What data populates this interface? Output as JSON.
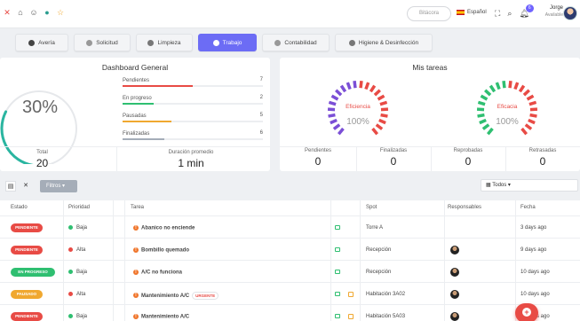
{
  "header": {
    "bitacora_label": "Bitácora",
    "language_label": "Español",
    "notification_count": "6",
    "user_name": "Jorge",
    "user_status": "Available"
  },
  "tabs": [
    {
      "label": "Avería",
      "active": false
    },
    {
      "label": "Solicitud",
      "active": false
    },
    {
      "label": "Limpieza",
      "active": false
    },
    {
      "label": "Trabajo",
      "active": true
    },
    {
      "label": "Contabilidad",
      "active": false
    },
    {
      "label": "Higiene & Desinfección",
      "active": false
    }
  ],
  "dashboard": {
    "title": "Dashboard General",
    "percent": "30%",
    "percent_value": 0.3,
    "stats": [
      {
        "label": "Pendientes",
        "value": "7",
        "color": "#e84b45",
        "fill": 0.5
      },
      {
        "label": "En progreso",
        "value": "2",
        "color": "#2fbf71",
        "fill": 0.22
      },
      {
        "label": "Pausadas",
        "value": "5",
        "color": "#f0a830",
        "fill": 0.35
      },
      {
        "label": "Finalizadas",
        "value": "6",
        "color": "#a5adb8",
        "fill": 0.3
      }
    ],
    "total_label": "Total",
    "total_value": "20",
    "duration_label": "Duración promedio",
    "duration_value": "1 min"
  },
  "mytasks": {
    "title": "Mis tareas",
    "efficiency_label": "Eficiencia",
    "efficiency_pct": "100%",
    "efficacy_label": "Eficacia",
    "efficacy_pct": "100%",
    "counts": [
      {
        "label": "Pendientes",
        "value": "0"
      },
      {
        "label": "Finalizadas",
        "value": "0"
      },
      {
        "label": "Reprobadas",
        "value": "0"
      },
      {
        "label": "Retrasadas",
        "value": "0"
      }
    ]
  },
  "filterbar": {
    "filtros_label": "Filtros",
    "todos_label": "Todos"
  },
  "table": {
    "headers": {
      "estado": "Estado",
      "prioridad": "Prioridad",
      "tarea": "Tarea",
      "spot": "Spot",
      "responsables": "Responsables",
      "fecha": "Fecha"
    },
    "rows": [
      {
        "estado": "PENDIENTE",
        "estado_color": "#e84b45",
        "prioridad": "Baja",
        "prio_color": "#2fbf71",
        "tarea": "Abanico no enciende",
        "urgente": "",
        "spot": "Torre A",
        "fecha": "3 days ago"
      },
      {
        "estado": "PENDIENTE",
        "estado_color": "#e84b45",
        "prioridad": "Alta",
        "prio_color": "#e84b45",
        "tarea": "Bombillo quemado",
        "urgente": "",
        "spot": "Recepción",
        "fecha": "9 days ago"
      },
      {
        "estado": "EN PROGRESO",
        "estado_color": "#2fbf71",
        "prioridad": "Baja",
        "prio_color": "#2fbf71",
        "tarea": "A/C no funciona",
        "urgente": "",
        "spot": "Recepción",
        "fecha": "10 days ago"
      },
      {
        "estado": "PAUSADO",
        "estado_color": "#f0a830",
        "prioridad": "Alta",
        "prio_color": "#e84b45",
        "tarea": "Mantenimiento A/C",
        "urgente": "URGENTE",
        "spot": "Habitación 3A02",
        "fecha": "10 days ago"
      },
      {
        "estado": "PENDIENTE",
        "estado_color": "#e84b45",
        "prioridad": "Baja",
        "prio_color": "#2fbf71",
        "tarea": "Mantenimiento A/C",
        "urgente": "",
        "spot": "Habitación 5A03",
        "fecha": "10 days ago"
      }
    ]
  },
  "colors": {
    "accent": "#6c6cf5",
    "danger": "#e84b45",
    "success": "#2fbf71",
    "warning": "#f0a830"
  }
}
